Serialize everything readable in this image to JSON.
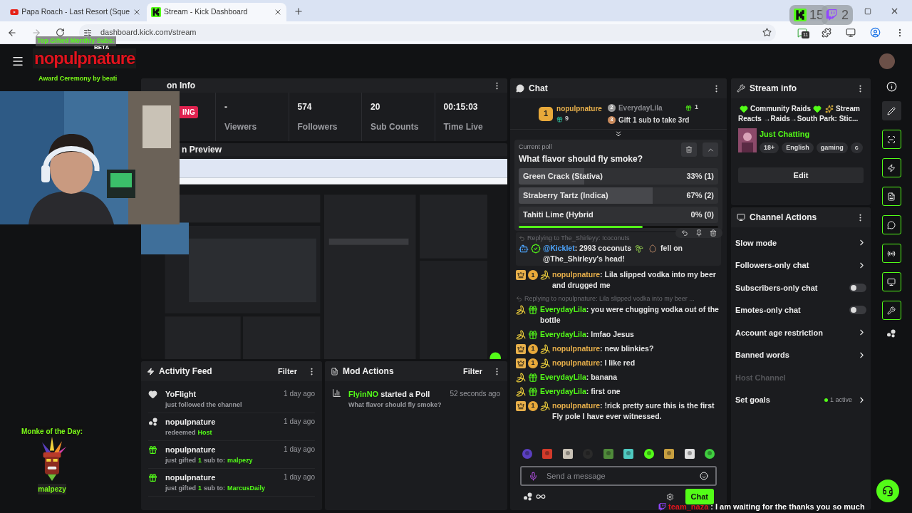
{
  "browser": {
    "tabs": [
      {
        "title": "Papa Roach - Last Resort (Sque",
        "selected": false,
        "kind": "youtube"
      },
      {
        "title": "Stream - Kick Dashboard",
        "selected": true,
        "kind": "kick"
      }
    ],
    "url": "dashboard.kick.com/stream",
    "extension_badge": "11"
  },
  "overlays": {
    "kick_count": "15",
    "twitch_count": "2",
    "top_label": "Top Gifted Monthly Subs:",
    "logo": "nopulpnature",
    "logo_tag": "BETA",
    "subtitle": "Award Ceremony by beati",
    "monke_title": "Monke of the Day:",
    "monke_name": "malpezy",
    "ticker_user": "team_naza",
    "ticker_text": ": I am waiting for the thanks you so much"
  },
  "session_info": {
    "title": "on Info",
    "badge": "ING",
    "stats": [
      {
        "value": "-",
        "label": "Viewers"
      },
      {
        "value": "574",
        "label": "Followers"
      },
      {
        "value": "20",
        "label": "Sub Counts"
      },
      {
        "value": "00:15:03",
        "label": "Time Live"
      }
    ]
  },
  "preview": {
    "title": "n Preview"
  },
  "activity_feed": {
    "title": "Activity Feed",
    "filter": "Filter",
    "items": [
      {
        "kind": "follow",
        "name": "YoFlight",
        "time": "1 day ago",
        "detail": [
          {
            "text": "just followed the channel",
            "accent": false
          }
        ]
      },
      {
        "kind": "points",
        "name": "nopulpnature",
        "time": "1 day ago",
        "detail": [
          {
            "text": "redeemed",
            "accent": false
          },
          {
            "text": "Host",
            "accent": true
          }
        ]
      },
      {
        "kind": "gift",
        "name": "nopulpnature",
        "time": "1 day ago",
        "detail": [
          {
            "text": "just gifted",
            "accent": false
          },
          {
            "text": "1",
            "accent": true
          },
          {
            "text": "sub to:",
            "accent": false
          },
          {
            "text": "malpezy",
            "accent": true
          }
        ]
      },
      {
        "kind": "gift",
        "name": "nopulpnature",
        "time": "1 day ago",
        "detail": [
          {
            "text": "just gifted",
            "accent": false
          },
          {
            "text": "1",
            "accent": true
          },
          {
            "text": "sub to:",
            "accent": false
          },
          {
            "text": "MarcusDaily",
            "accent": true
          }
        ]
      }
    ]
  },
  "mod_actions": {
    "title": "Mod Actions",
    "filter": "Filter",
    "items": [
      {
        "user": "FlyinNO",
        "action": "started a Poll",
        "time": "52 seconds ago",
        "detail": "What flavor should fly smoke?"
      }
    ]
  },
  "chat": {
    "title": "Chat",
    "leaders": [
      {
        "rank": "1",
        "name": "nopulpnature",
        "gifts": "9",
        "color": "#e8a93a"
      },
      {
        "rank": "2",
        "name": "EverydayLila",
        "gifts": "1",
        "color": "#9a9a9a"
      },
      {
        "rank": "3",
        "name": "Gift 1 sub to take 3rd",
        "color": "#c98a5c"
      }
    ],
    "poll": {
      "label": "Current poll",
      "question": "What flavor should fly smoke?",
      "options": [
        {
          "text": "Green Crack (Stativa)",
          "result": "33% (1)",
          "level": 0.33
        },
        {
          "text": "Straberry Tartz (Indica)",
          "result": "67% (2)",
          "level": 0.67
        },
        {
          "text": "Tahiti Lime (Hybrid",
          "result": "0% (0)",
          "level": 0
        }
      ],
      "timer": {
        "level": 0.62
      }
    },
    "messages": [
      {
        "reply": "Replying to The_Shirleyy: !coconuts",
        "highlighted": true,
        "kind": "bot",
        "user": "@Kicklet",
        "text": ": 2993 coconuts",
        "after": [
          {
            "kind": "palm"
          },
          {
            "kind": "coconut"
          },
          {
            "kind": "text",
            "text": "fell on"
          },
          {
            "kind": "text",
            "text": "@The_Shirleyy's head!"
          }
        ]
      },
      {
        "highlighted": false,
        "kind": "owner",
        "sub_badge": "1",
        "user": "nopulpnature",
        "text": ": Lila slipped vodka into my beer and drugged me"
      },
      {
        "reply": "Replying to nopulpnature: Lila slipped vodka into my beer ...",
        "highlighted": false,
        "kind": "gifter",
        "user": "EverydayLila",
        "text": ": you were chugging vodka out of the bottle"
      },
      {
        "highlighted": false,
        "kind": "gifter",
        "user": "EverydayLila",
        "text": ": lmfao Jesus"
      },
      {
        "highlighted": false,
        "kind": "owner",
        "sub_badge": "1",
        "user": "nopulpnature",
        "text": ": new blinkies?"
      },
      {
        "highlighted": false,
        "kind": "owner",
        "sub_badge": "1",
        "user": "nopulpnature",
        "text": ": I like red"
      },
      {
        "highlighted": false,
        "kind": "gifter",
        "user": "EverydayLila",
        "text": ": banana"
      },
      {
        "highlighted": false,
        "kind": "gifter",
        "user": "EverydayLila",
        "text": ": first one"
      },
      {
        "highlighted": false,
        "kind": "owner",
        "sub_badge": "1",
        "user": "nopulpnature",
        "text": ": !rick pretty sure this is the first Fly pole I have ever witnessed."
      }
    ],
    "input_placeholder": "Send a message",
    "send": "Chat"
  },
  "stream_info": {
    "title": "Stream info",
    "stream_title": [
      {
        "kind": "heart"
      },
      {
        "kind": "text",
        "text": "Community Raids"
      },
      {
        "kind": "heart"
      },
      {
        "kind": "sparkle"
      },
      {
        "kind": "text",
        "text": "Stream"
      },
      {
        "kind": "text",
        "text": "Reacts →Raids→South Park: Stic..."
      }
    ],
    "category": "Just Chatting",
    "tags": [
      "18+",
      "English",
      "gaming",
      "c"
    ],
    "edit": "Edit"
  },
  "channel_actions": {
    "title": "Channel Actions",
    "items": [
      {
        "kind": "link",
        "label": "Slow mode"
      },
      {
        "kind": "link",
        "label": "Followers-only chat"
      },
      {
        "kind": "toggle",
        "label": "Subscribers-only chat",
        "on": false
      },
      {
        "kind": "toggle",
        "label": "Emotes-only chat",
        "on": false
      },
      {
        "kind": "link",
        "label": "Account age restriction"
      },
      {
        "kind": "link",
        "label": "Banned words"
      },
      {
        "kind": "disabled",
        "label": "Host Channel"
      },
      {
        "kind": "link",
        "label": "Set goals",
        "status": "1 active"
      }
    ]
  }
}
